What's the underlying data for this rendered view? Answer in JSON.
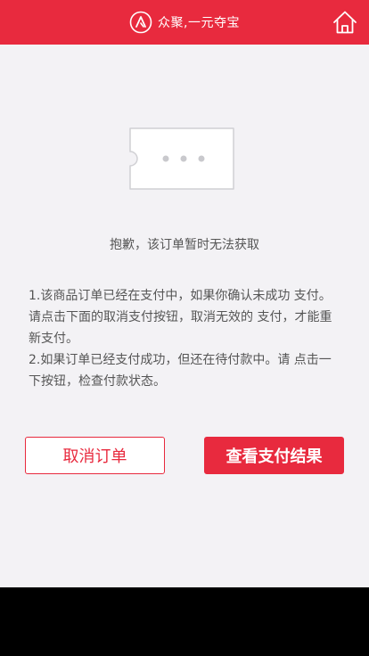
{
  "header": {
    "brand_text": "众聚,一元夺宝",
    "logo_icon": "brand-logo-icon",
    "home_icon": "home-icon",
    "background": "#e82a3e"
  },
  "main": {
    "illustration_icon": "ticket-icon",
    "message": "抱歉，该订单暂时无法获取",
    "notes": [
      "1.该商品订单已经在支付中，如果你确认未成功 支付。请点击下面的取消支付按钮，取消无效的 支付，才能重新支付。",
      "2.如果订单已经支付成功，但还在待付款中。请 点击一下按钮，检查付款状态。"
    ]
  },
  "actions": {
    "cancel_label": "取消订单",
    "check_label": "查看支付结果"
  },
  "colors": {
    "accent": "#e82a3e",
    "page_bg": "#f3f2f5",
    "text": "#555555"
  }
}
